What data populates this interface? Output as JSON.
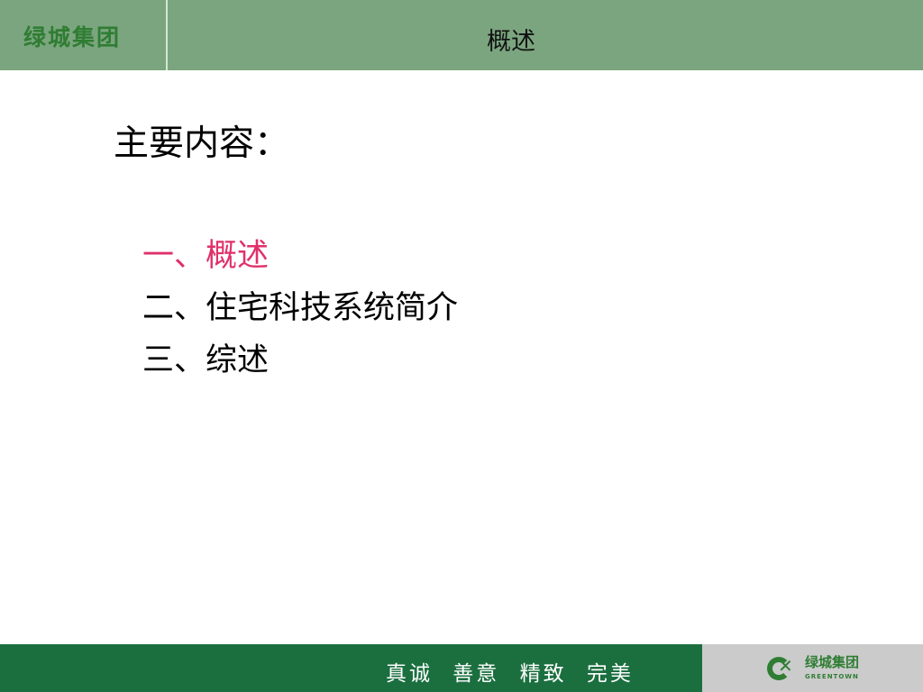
{
  "header": {
    "brand": "绿城集团",
    "title": "概述"
  },
  "main": {
    "heading": "主要内容：",
    "outline": [
      {
        "label": "一、概述",
        "highlighted": true
      },
      {
        "label": "二、住宅科技系统简介",
        "highlighted": false
      },
      {
        "label": "三、综述",
        "highlighted": false
      }
    ]
  },
  "footer": {
    "motto": "真诚 善意 精致 完美",
    "logo": {
      "name_cn": "绿城集团",
      "name_en": "GREENTOWN"
    }
  },
  "colors": {
    "header_bg": "#7ba57f",
    "footer_bg": "#1b6f3f",
    "brand_green": "#2f7d33",
    "highlight": "#e0306a"
  }
}
